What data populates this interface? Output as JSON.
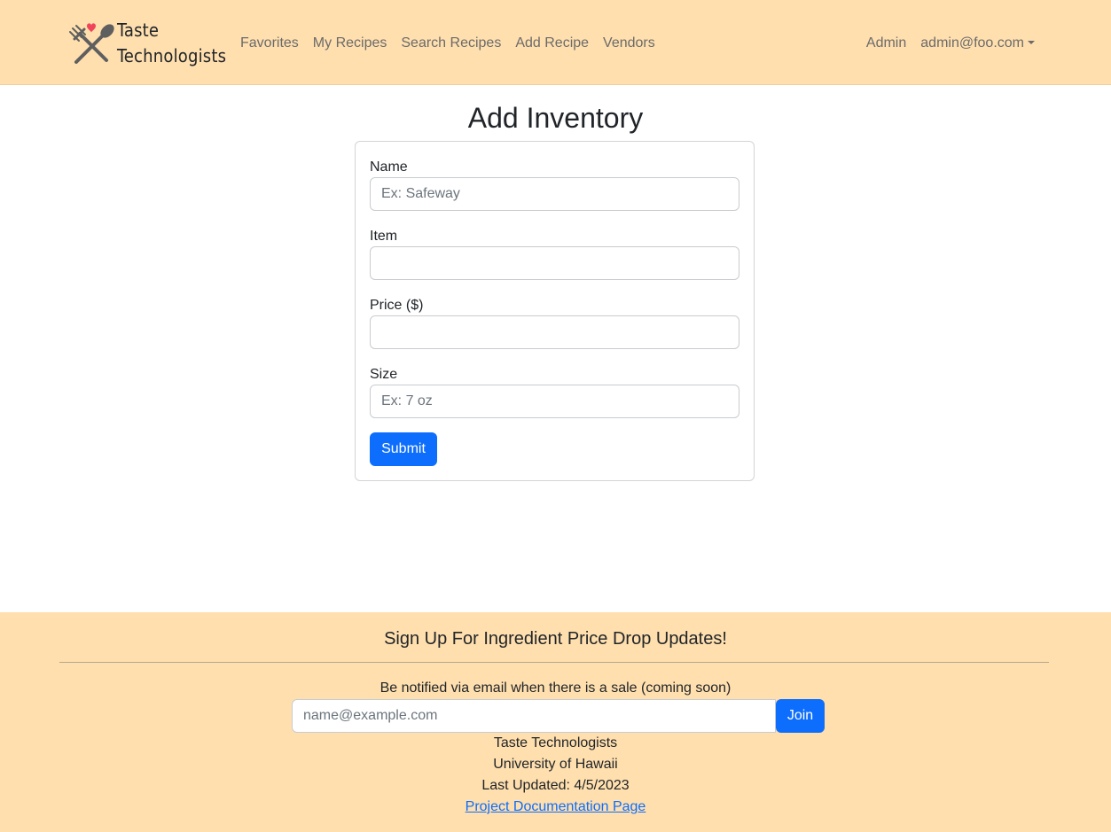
{
  "navbar": {
    "brand_line1": "Taste",
    "brand_line2": "Technologists",
    "links": [
      "Favorites",
      "My Recipes",
      "Search Recipes",
      "Add Recipe",
      "Vendors"
    ],
    "admin_label": "Admin",
    "user_email": "admin@foo.com"
  },
  "page": {
    "title": "Add Inventory"
  },
  "form": {
    "name_label": "Name",
    "name_placeholder": "Ex: Safeway",
    "name_value": "",
    "item_label": "Item",
    "item_value": "",
    "price_label": "Price ($)",
    "price_value": "",
    "size_label": "Size",
    "size_placeholder": "Ex: 7 oz",
    "size_value": "",
    "submit_label": "Submit"
  },
  "footer": {
    "heading": "Sign Up For Ingredient Price Drop Updates!",
    "notice": "Be notified via email when there is a sale (coming soon)",
    "email_placeholder": "name@example.com",
    "join_label": "Join",
    "org_name": "Taste Technologists",
    "university": "University of Hawaii",
    "last_updated": "Last Updated: 4/5/2023",
    "doc_link": "Project Documentation Page"
  },
  "colors": {
    "nav_bg": "#ffdfae",
    "primary": "#0d6efd",
    "heart": "#f0445a"
  }
}
